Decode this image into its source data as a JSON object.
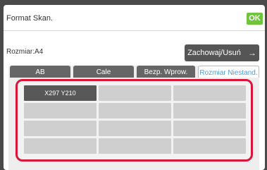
{
  "header": {
    "title": "Format Skan.",
    "ok_label": "OK"
  },
  "size": {
    "label": "Rozmiar:A4"
  },
  "actions": {
    "save_delete_label": "Zachowaj/Usuń",
    "save_delete_icon": "arrow-right-icon"
  },
  "tabs": [
    {
      "label": "AB",
      "active": false
    },
    {
      "label": "Cale",
      "active": false
    },
    {
      "label": "Bezp. Wprow.",
      "active": false
    },
    {
      "label": "Rozmiar Niestand.",
      "active": true
    }
  ],
  "custom_sizes": [
    [
      "X297 Y210",
      "",
      ""
    ],
    [
      "",
      "",
      ""
    ],
    [
      "",
      "",
      ""
    ],
    [
      "",
      "",
      ""
    ]
  ],
  "colors": {
    "ok_green": "#6ec43a",
    "highlight_red": "#d9163a",
    "active_tab_text": "#4a9fd6",
    "dark_button": "#555555"
  }
}
